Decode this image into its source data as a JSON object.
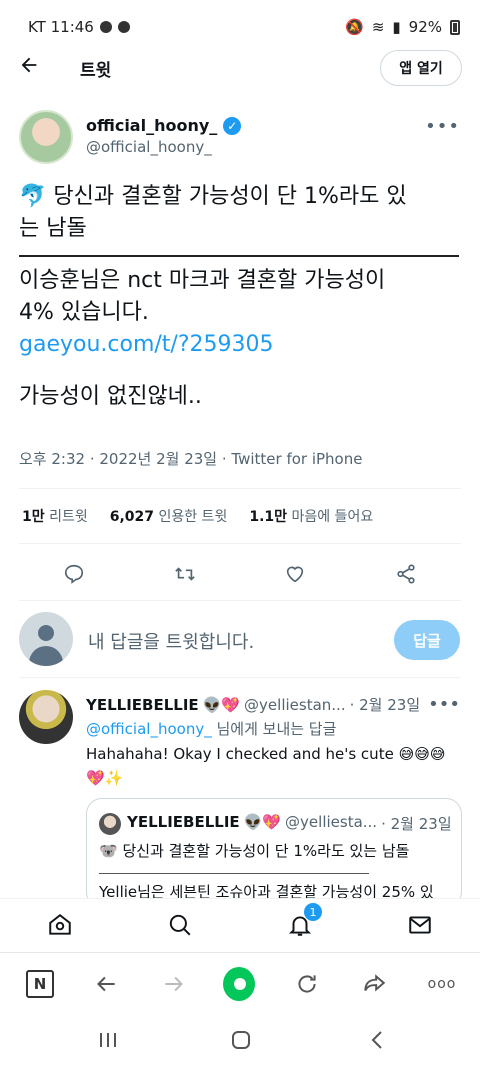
{
  "status_bar": {
    "carrier_time": "KT 11:46",
    "battery": "92%"
  },
  "header": {
    "title": "트윗",
    "open_app_label": "앱 열기"
  },
  "tweet": {
    "author_name": "official_hoony_",
    "author_handle": "@official_hoony_",
    "line1": "당신과 결혼할 가능성이 단 1%라도 있",
    "line2": "는 남돌",
    "line3": "이승훈님은 nct 마크과 결혼할 가능성이",
    "line4": "4% 있습니다.",
    "link": "gaeyou.com/t/?259305",
    "line5": "가능성이 없진않네..",
    "meta": "오후 2:32 · 2022년 2월 23일 · Twitter for iPhone"
  },
  "stats": {
    "retweets_count": "1만",
    "retweets_label": "리트윗",
    "quotes_count": "6,027",
    "quotes_label": "인용한 트윗",
    "likes_count": "1.1만",
    "likes_label": "마음에 들어요"
  },
  "reply_box": {
    "placeholder": "내 답글을 트윗합니다.",
    "button_label": "답글"
  },
  "reply_tweet": {
    "name": "YELLIEBELLIE",
    "handle": "@yelliestan...",
    "date": "· 2월 23일",
    "replying_to_handle": "@official_hoony_",
    "replying_to_suffix": " 님에게 보내는 답글",
    "text": "Hahahaha! Okay I checked and he's cute 😅😅😅 💖✨"
  },
  "quote_tweet": {
    "name": "YELLIEBELLIE",
    "handle": "@yelliesta...",
    "date": "· 2월 23일",
    "text": "당신과 결혼할 가능성이 단 1%라도 있는 남돌",
    "text2": "Yellie님은 세븐틴 조슈아과 결혼할 가능성이 25% 있"
  },
  "bottom_nav": {
    "notification_badge": "1"
  },
  "colors": {
    "accent": "#1d9bf0",
    "reply_button": "#8ecdf8",
    "naver_green": "#03c75a"
  }
}
